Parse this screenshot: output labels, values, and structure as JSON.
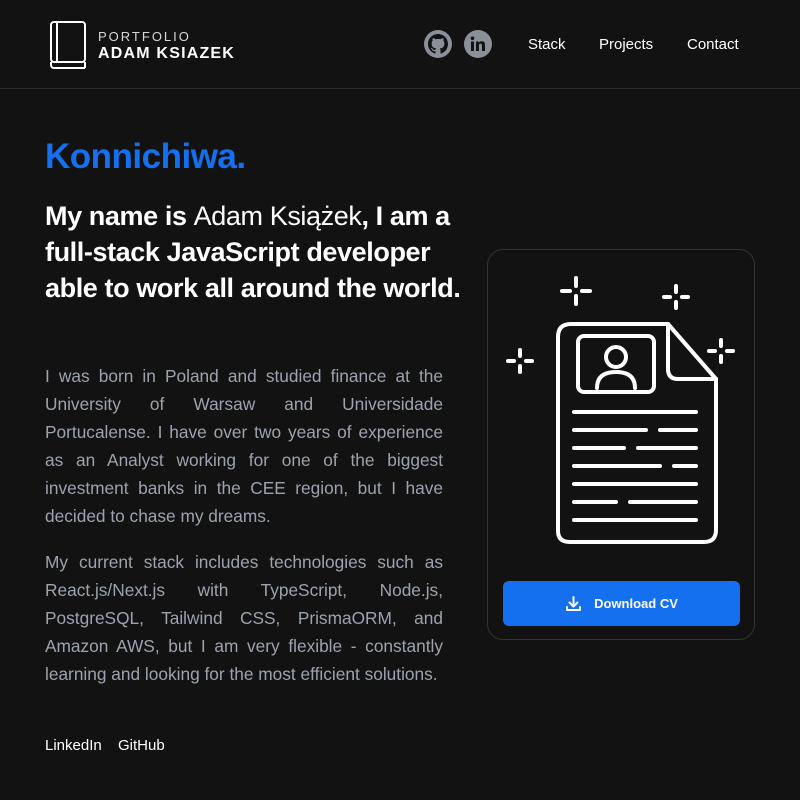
{
  "header": {
    "logo_small": "PORTFOLIO",
    "logo_big": "ADAM KSIAZEK",
    "nav": [
      "Stack",
      "Projects",
      "Contact"
    ],
    "social_icons": [
      "github-icon",
      "linkedin-icon"
    ]
  },
  "hero": {
    "greeting": "Konnichiwa.",
    "headline_part1": "My name is ",
    "headline_name": "Adam Książek",
    "headline_part2": ", I am a full-stack JavaScript developer able to work all around the world.",
    "paragraph1": "I was born in Poland and studied finance at the University of Warsaw and Universidade Portucalense. I have over two years of experience as an Analyst working for one of the biggest investment banks in the CEE region, but I have decided to chase my dreams.",
    "paragraph2": "My current stack includes technologies such as React.js/Next.js with TypeScript, Node.js, PostgreSQL, Tailwind CSS, PrismaORM, and Amazon AWS, but I am very flexible - constantly learning and looking for the most efficient solutions.",
    "links": [
      "LinkedIn",
      "GitHub"
    ]
  },
  "cv_card": {
    "icon": "cv-document-icon",
    "button_label": "Download CV",
    "button_icon": "download-icon"
  },
  "colors": {
    "background": "#121212",
    "accent": "#1570ef",
    "paragraph": "#9ca3af",
    "social_icon_bg": "#8a8f98"
  }
}
